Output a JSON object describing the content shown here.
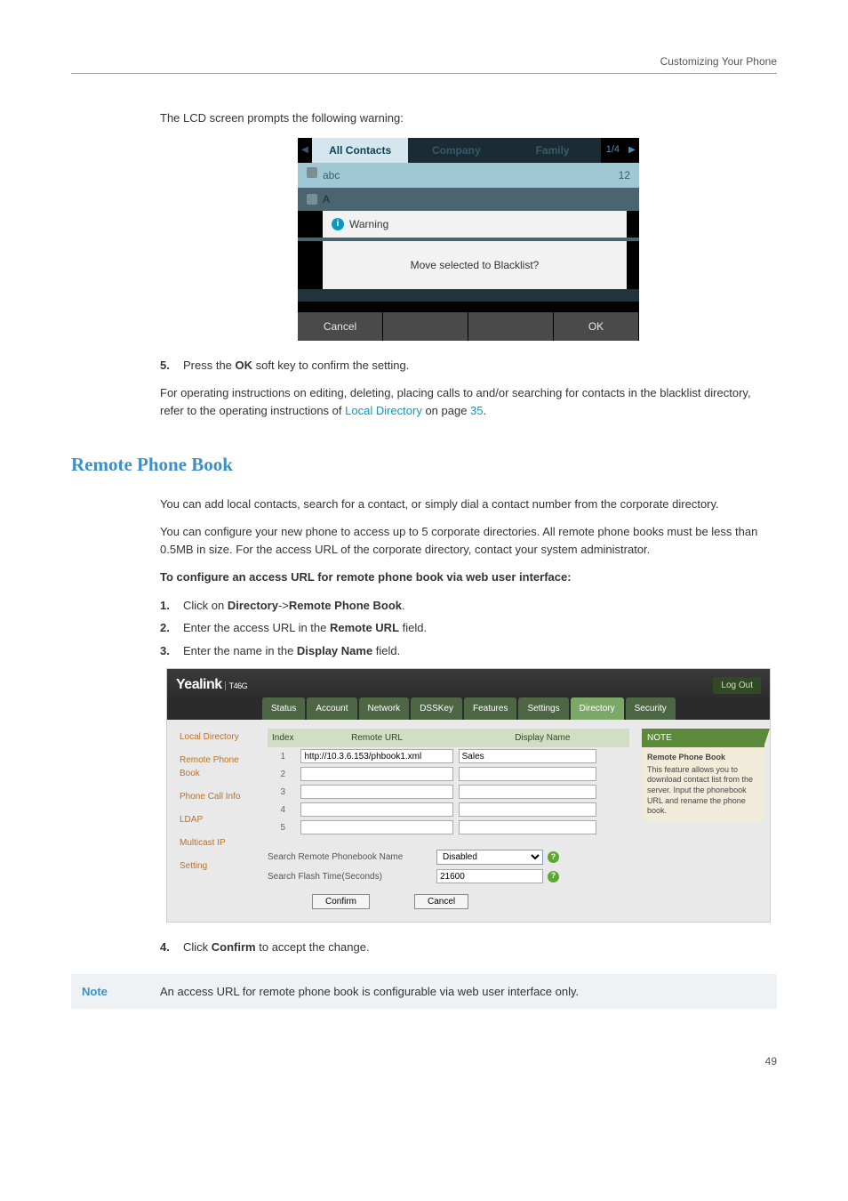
{
  "header": {
    "title": "Customizing Your Phone"
  },
  "intro_line": "The LCD screen prompts the following warning:",
  "lcd": {
    "tabs": [
      "All Contacts",
      "Company",
      "Family"
    ],
    "page_indicator": "1/4",
    "row1_name": "abc",
    "row1_num": "12",
    "letter_hint": "A",
    "warning_label": "Warning",
    "dialog_text": "Move selected to Blacklist?",
    "softkeys": {
      "left": "Cancel",
      "right": "OK"
    }
  },
  "step5": {
    "num": "5.",
    "pre": "Press the ",
    "bold": "OK",
    "post": " soft key to confirm the setting."
  },
  "para_after5_a": "For operating instructions on editing, deleting, placing calls to and/or searching for contacts in the blacklist directory, refer to the operating instructions of ",
  "para_after5_link": "Local Directory",
  "para_after5_b": " on page ",
  "para_after5_page": "35",
  "para_after5_c": ".",
  "section_title": "Remote Phone  Book",
  "rp_para1": "You can add local contacts, search for a contact, or simply dial a contact number from the corporate directory.",
  "rp_para2": "You can configure your new phone to access up to 5 corporate directories. All remote phone books must be less than 0.5MB in size. For the access URL of the corporate directory, contact your system administrator.",
  "rp_howto": "To configure an access URL for remote phone book via web user interface:",
  "rp_steps": [
    {
      "num": "1.",
      "pre": "Click on ",
      "b1": "Directory",
      "mid": "->",
      "b2": "Remote Phone Book",
      "post": "."
    },
    {
      "num": "2.",
      "pre": "Enter the access URL in the ",
      "b1": "Remote URL",
      "post": " field."
    },
    {
      "num": "3.",
      "pre": "Enter the name in the ",
      "b1": "Display Name",
      "post": " field."
    }
  ],
  "webui": {
    "logo": "Yealink",
    "model": "T46G",
    "logout": "Log Out",
    "tabs": [
      "Status",
      "Account",
      "Network",
      "DSSKey",
      "Features",
      "Settings",
      "Directory",
      "Security"
    ],
    "active_tab": "Directory",
    "side": [
      "Local Directory",
      "Remote Phone Book",
      "Phone Call Info",
      "LDAP",
      "Multicast IP",
      "Setting"
    ],
    "th_index": "Index",
    "th_url": "Remote URL",
    "th_name": "Display Name",
    "rows": [
      {
        "idx": "1",
        "url": "http://10.3.6.153/phbook1.xml",
        "name": "Sales"
      },
      {
        "idx": "2",
        "url": "",
        "name": ""
      },
      {
        "idx": "3",
        "url": "",
        "name": ""
      },
      {
        "idx": "4",
        "url": "",
        "name": ""
      },
      {
        "idx": "5",
        "url": "",
        "name": ""
      }
    ],
    "search_name_lbl": "Search Remote Phonebook Name",
    "search_name_val": "Disabled",
    "flash_lbl": "Search Flash Time(Seconds)",
    "flash_val": "21600",
    "confirm_btn": "Confirm",
    "cancel_btn": "Cancel",
    "note_head": "NOTE",
    "note_title": "Remote Phone Book",
    "note_text": "This feature allows you to download contact list from the server. Input the phonebook URL and rename the phone book."
  },
  "step4": {
    "num": "4.",
    "pre": "Click ",
    "b": "Confirm",
    "post": " to accept the change."
  },
  "note_block": {
    "tag": "Note",
    "text": "An access URL for remote phone book is configurable via web user interface only."
  },
  "page_number": "49"
}
